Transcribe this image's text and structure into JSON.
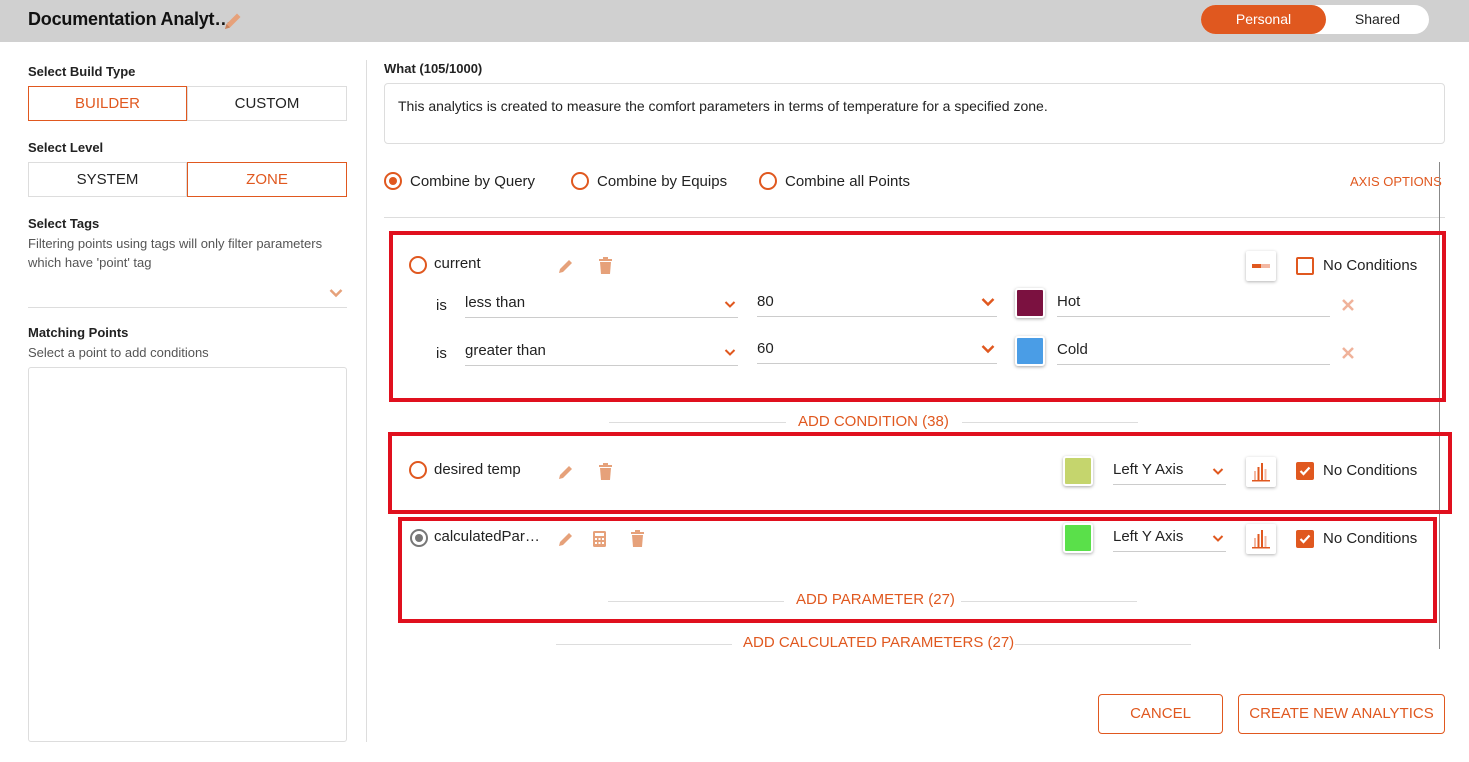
{
  "header": {
    "title": "Documentation Analyt…",
    "toggle": {
      "personal": "Personal",
      "shared": "Shared",
      "active": "Personal"
    }
  },
  "left": {
    "build_type_label": "Select Build Type",
    "build_types": [
      "BUILDER",
      "CUSTOM"
    ],
    "build_type_selected": "BUILDER",
    "level_label": "Select Level",
    "levels": [
      "SYSTEM",
      "ZONE"
    ],
    "level_selected": "ZONE",
    "tags_label": "Select Tags",
    "tags_help": "Filtering points using tags will only filter parameters which have 'point' tag",
    "matching_label": "Matching Points",
    "matching_help": "Select a point to add conditions"
  },
  "what": {
    "label": "What (105/1000)",
    "text": "This analytics is created to measure the comfort parameters in terms of temperature for a specified zone."
  },
  "combine": {
    "options": [
      "Combine by Query",
      "Combine by Equips",
      "Combine all Points"
    ],
    "selected": "Combine by Query",
    "axis_options": "AXIS OPTIONS"
  },
  "params": [
    {
      "name": "current",
      "no_conditions_label": "No Conditions",
      "no_conditions_checked": false,
      "conditions": [
        {
          "is": "is",
          "operator": "less than",
          "value": "80",
          "color": "#7b1140",
          "label": "Hot"
        },
        {
          "is": "is",
          "operator": "greater than",
          "value": "60",
          "color": "#4a9de6",
          "label": "Cold"
        }
      ],
      "add_condition": "ADD CONDITION (38)"
    },
    {
      "name": "desired temp",
      "color": "#c5d56d",
      "axis": "Left Y Axis",
      "no_conditions_label": "No Conditions",
      "no_conditions_checked": true
    },
    {
      "name": "calculatedPar…",
      "color": "#5ae04a",
      "axis": "Left Y Axis",
      "no_conditions_label": "No Conditions",
      "no_conditions_checked": true,
      "add_parameter": "ADD PARAMETER (27)"
    }
  ],
  "add_calculated": "ADD CALCULATED PARAMETERS (27)",
  "footer": {
    "cancel": "CANCEL",
    "create": "CREATE NEW ANALYTICS"
  },
  "colors": {
    "accent": "#e0581f",
    "highlight": "#e0101e",
    "topbar": "#d0d0d0"
  }
}
